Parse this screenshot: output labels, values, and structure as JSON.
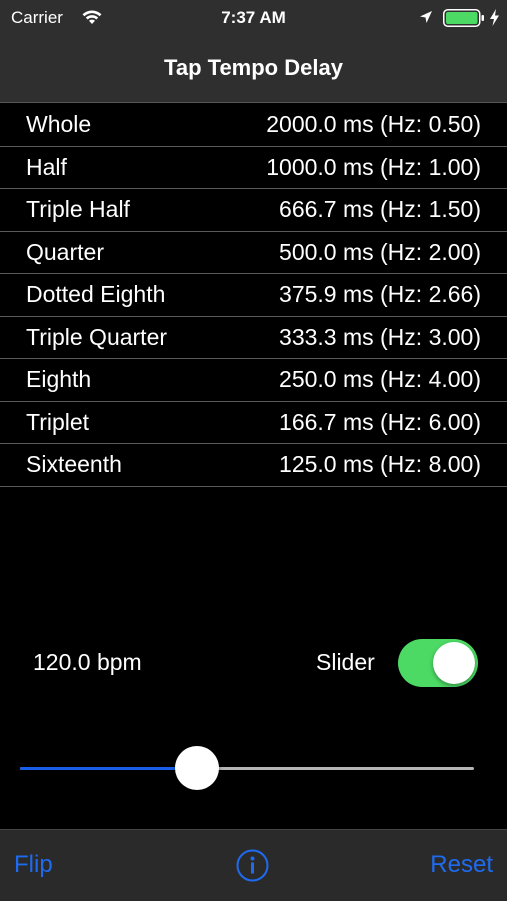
{
  "status_bar": {
    "carrier": "Carrier",
    "time": "7:37 AM",
    "icons": [
      "wifi-icon",
      "location-icon",
      "battery-icon",
      "charging-icon"
    ],
    "battery_color": "#4cd964"
  },
  "nav": {
    "title": "Tap Tempo Delay"
  },
  "rows": [
    {
      "label": "Whole",
      "value": "2000.0 ms (Hz: 0.50)"
    },
    {
      "label": "Half",
      "value": "1000.0 ms (Hz: 1.00)"
    },
    {
      "label": "Triple Half",
      "value": "666.7 ms (Hz: 1.50)"
    },
    {
      "label": "Quarter",
      "value": "500.0 ms (Hz: 2.00)"
    },
    {
      "label": "Dotted Eighth",
      "value": "375.9 ms (Hz: 2.66)"
    },
    {
      "label": "Triple Quarter",
      "value": "333.3 ms (Hz: 3.00)"
    },
    {
      "label": "Eighth",
      "value": "250.0 ms (Hz: 4.00)"
    },
    {
      "label": "Triplet",
      "value": "166.7 ms (Hz: 6.00)"
    },
    {
      "label": "Sixteenth",
      "value": "125.0 ms (Hz: 8.00)"
    }
  ],
  "controls": {
    "bpm": "120.0 bpm",
    "slider_label": "Slider",
    "slider_toggle_on": true,
    "slider_fraction": 0.39,
    "toggle_color": "#4cd964",
    "slider_fill_color": "#1a5de8"
  },
  "toolbar": {
    "flip_label": "Flip",
    "info_icon": "info-icon",
    "reset_label": "Reset",
    "accent": "#1e6bf0"
  }
}
